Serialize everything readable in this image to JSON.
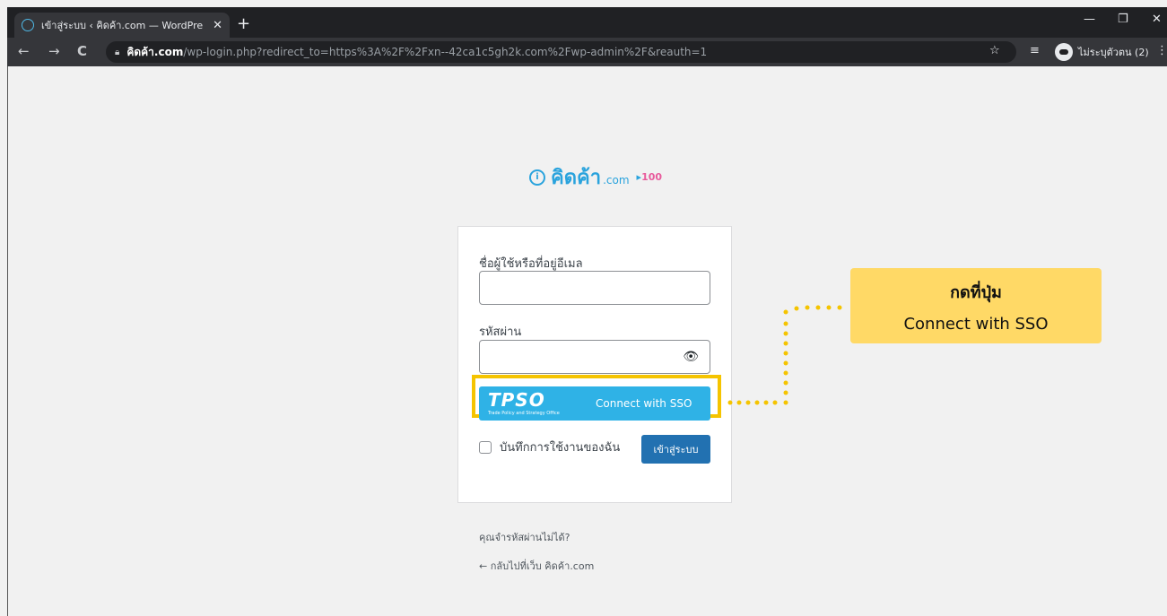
{
  "browser": {
    "tab_title": "เข้าสู่ระบบ ‹ คิดค้า.com — WordPre",
    "tab_close": "✕",
    "new_tab": "+",
    "url_host": "คิดค้า.com",
    "url_path": "/wp-login.php?redirect_to=https%3A%2F%2Fxn--42ca1c5gh2k.com%2Fwp-admin%2F&reauth=1",
    "profile_label": "ไม่ระบุตัวตน (2)",
    "icons": [
      "back-icon",
      "forward-icon",
      "reload-icon",
      "lock-icon",
      "star-icon",
      "reading-list-icon",
      "incognito-icon",
      "menu-icon",
      "minimize-icon",
      "restore-icon",
      "close-icon"
    ]
  },
  "logo": {
    "text": "คิดค้า",
    "suffix": ".com",
    "badge": "100"
  },
  "login": {
    "username_label": "ชื่อผู้ใช้หรือที่อยู่อีเมล",
    "username_value": "",
    "password_label": "รหัสผ่าน",
    "password_value": "",
    "sso_logo": "TPSO",
    "sso_subtitle": "Trade Policy and Strategy Office",
    "sso_button": "Connect with SSO",
    "remember_label": "บันทึกการใช้งานของฉัน",
    "submit_label": "เข้าสู่ระบบ"
  },
  "links": {
    "lost_password": "คุณจำรหัสผ่านไม่ได้?",
    "back_to_site": "← กลับไปที่เว็บ คิดค้า.com"
  },
  "annotation": {
    "line1": "กดที่ปุ่ม",
    "line2": "Connect with SSO",
    "color": "#ffd966",
    "highlight_color": "#f5c400"
  }
}
